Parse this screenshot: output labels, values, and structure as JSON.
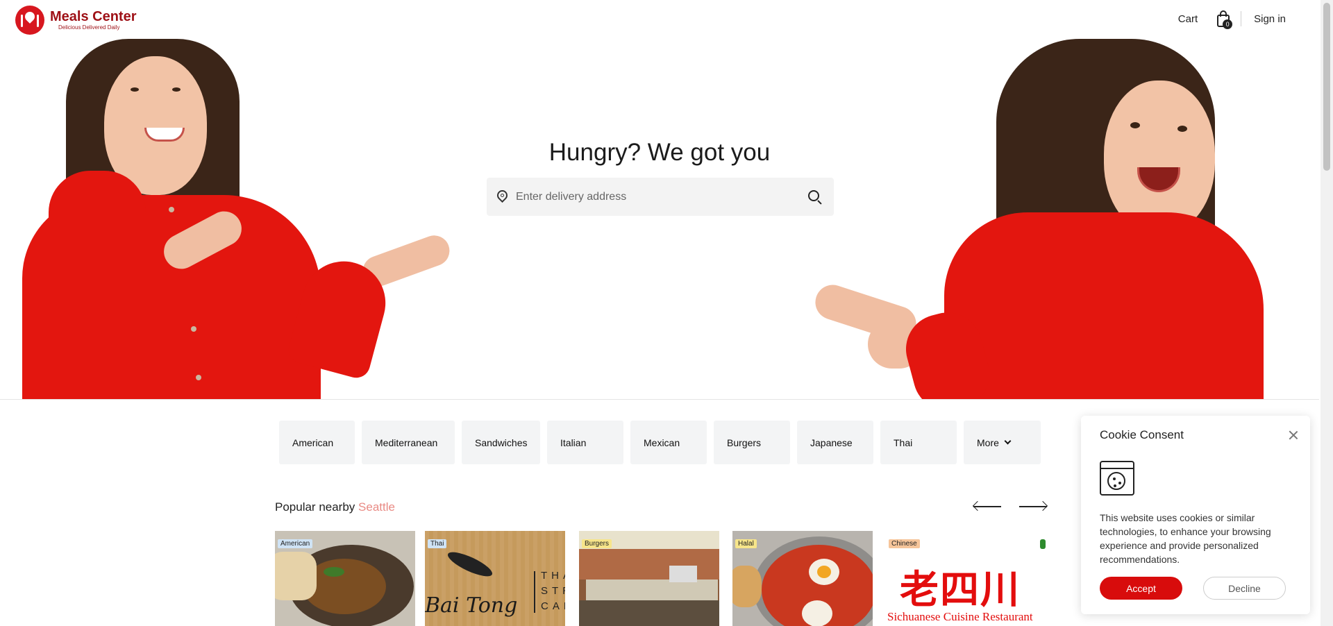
{
  "brand": {
    "name": "Meals Center",
    "tagline": "Delicious Delivered Daily",
    "color": "#9e1016"
  },
  "nav": {
    "cart_label": "Cart",
    "cart_count": "0",
    "signin_label": "Sign in"
  },
  "hero": {
    "title": "Hungry? We got you",
    "search_placeholder": "Enter delivery address"
  },
  "categories": [
    "American",
    "Mediterranean",
    "Sandwiches",
    "Italian",
    "Mexican",
    "Burgers",
    "Japanese",
    "Thai",
    "More"
  ],
  "popular": {
    "label": "Popular nearby",
    "city": "Seattle",
    "cards": [
      {
        "tag": "American",
        "tag_color": "#cfe3f5"
      },
      {
        "tag": "Thai",
        "tag_color": "#cfe3f5"
      },
      {
        "tag": "Burgers",
        "tag_color": "#f7e58a"
      },
      {
        "tag": "Halal",
        "tag_color": "#f7e58a"
      },
      {
        "tag": "Chinese",
        "tag_color": "#f6c59a",
        "logo_text": "老四川",
        "logo_sub": "Sichuanese Cuisine Restaurant"
      }
    ],
    "thai_card_text": [
      "Bai Tong",
      "THAI",
      "STREET",
      "CAFE"
    ]
  },
  "cookie": {
    "title": "Cookie Consent",
    "text": "This website uses cookies or similar technologies, to enhance your browsing experience and provide personalized recommendations.",
    "accept_label": "Accept",
    "decline_label": "Decline",
    "accent": "#d80c0c"
  }
}
